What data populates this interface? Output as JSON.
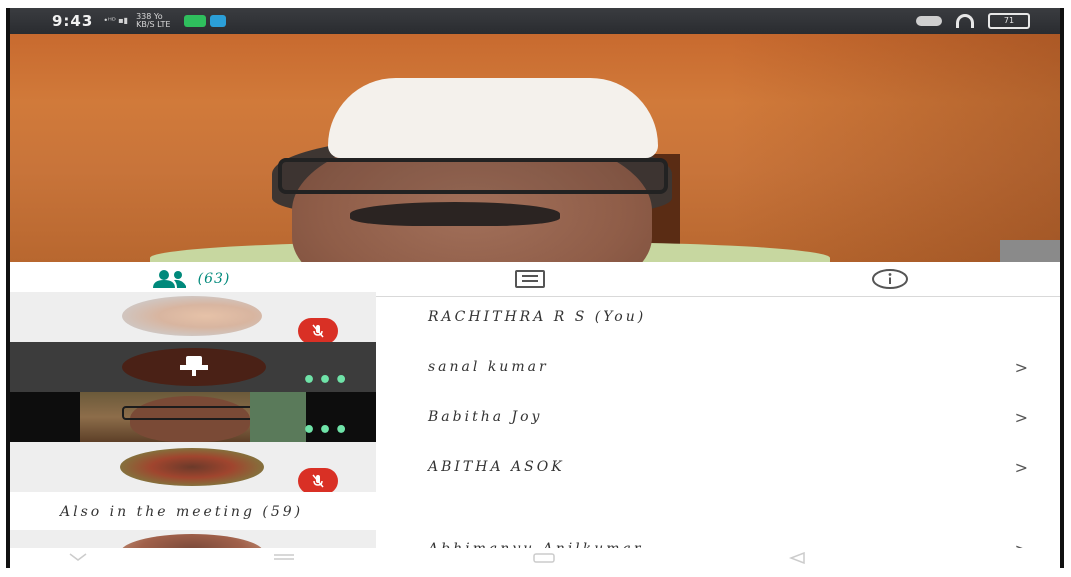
{
  "status_bar": {
    "time": "9:43",
    "signal": "•ᴴᴰ ▪▮",
    "network": "338 Yo\nKB/S LTE",
    "battery": "71"
  },
  "tabs": [
    {
      "id": "people",
      "icon": "people-icon",
      "label": "(63)",
      "active": true
    },
    {
      "id": "chat",
      "icon": "chat-icon",
      "label": "",
      "active": false
    },
    {
      "id": "info",
      "icon": "info-icon",
      "label": "",
      "active": false
    }
  ],
  "participants": [
    {
      "name": "RACHITHRA R S (You)",
      "muted": true,
      "chevron": ""
    },
    {
      "name": "sanal kumar",
      "muted": false,
      "chevron": ">"
    },
    {
      "name": "Babitha Joy",
      "muted": false,
      "chevron": ">"
    },
    {
      "name": "ABITHA ASOK",
      "muted": true,
      "chevron": ">"
    }
  ],
  "also_in_meeting": {
    "label": "Also in the meeting (59)",
    "first": {
      "name": "Abhimanyu Anilkumar",
      "chevron": ">"
    }
  },
  "colors": {
    "accent": "#00897b",
    "mic_off": "#d93025",
    "more_dots": "#6fe3a8"
  }
}
